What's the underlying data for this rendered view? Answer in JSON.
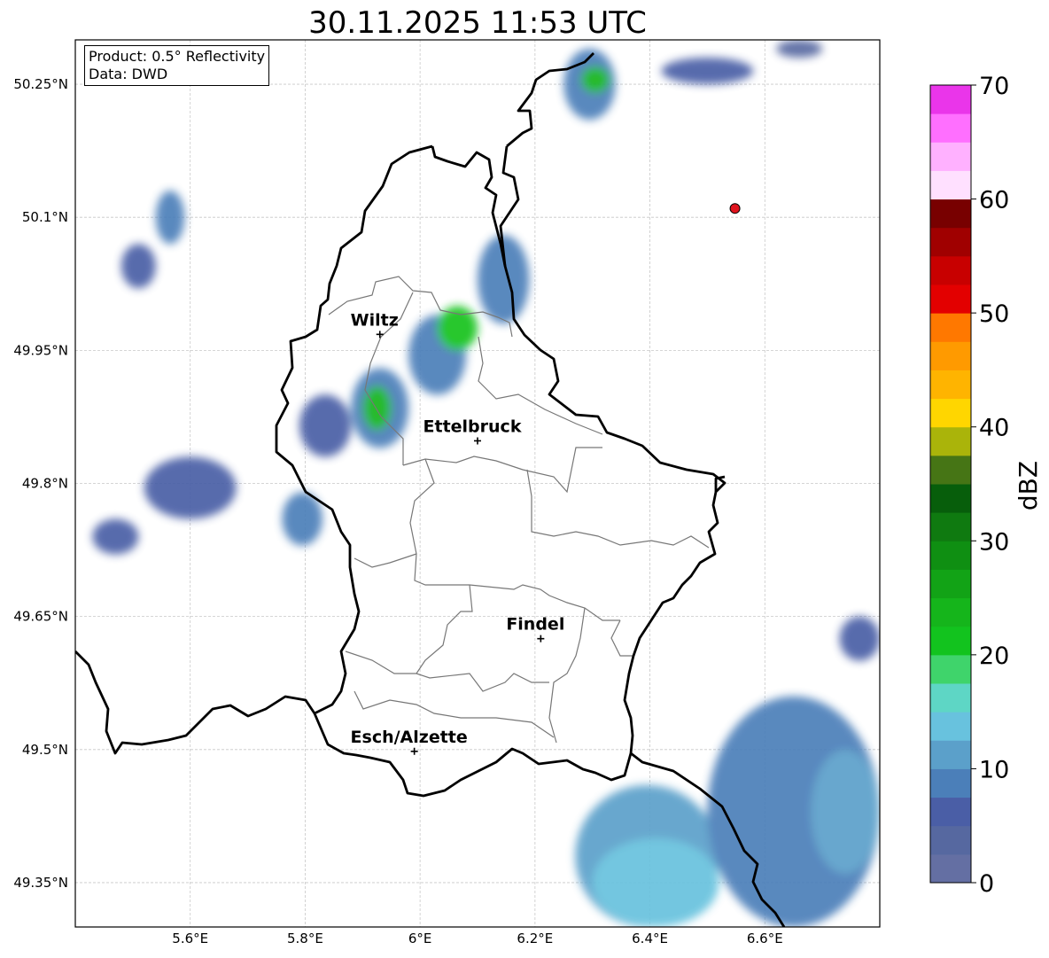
{
  "title": "30.11.2025 11:53 UTC",
  "info": {
    "product_line": "Product: 0.5° Reflectivity",
    "source_line": "Data: DWD"
  },
  "map": {
    "extent": {
      "lon_min": 5.4,
      "lon_max": 6.8,
      "lat_min": 49.3,
      "lat_max": 50.3
    },
    "lon_ticks": [
      {
        "v": 5.6,
        "label": "5.6°E"
      },
      {
        "v": 5.8,
        "label": "5.8°E"
      },
      {
        "v": 6.0,
        "label": "6°E"
      },
      {
        "v": 6.2,
        "label": "6.2°E"
      },
      {
        "v": 6.4,
        "label": "6.4°E"
      },
      {
        "v": 6.6,
        "label": "6.6°E"
      }
    ],
    "lat_ticks": [
      {
        "v": 50.25,
        "label": "50.25°N"
      },
      {
        "v": 50.1,
        "label": "50.1°N"
      },
      {
        "v": 49.95,
        "label": "49.95°N"
      },
      {
        "v": 49.8,
        "label": "49.8°N"
      },
      {
        "v": 49.65,
        "label": "49.65°N"
      },
      {
        "v": 49.5,
        "label": "49.5°N"
      },
      {
        "v": 49.35,
        "label": "49.35°N"
      }
    ],
    "cities": [
      {
        "name": "Wiltz",
        "lon": 5.93,
        "lat": 49.968
      },
      {
        "name": "Ettelbruck",
        "lon": 6.1,
        "lat": 49.848
      },
      {
        "name": "Findel",
        "lon": 6.21,
        "lat": 49.625
      },
      {
        "name": "Esch/Alzette",
        "lon": 5.99,
        "lat": 49.498
      }
    ],
    "radar_site": {
      "lon": 6.548,
      "lat": 50.11,
      "color": "#e0141e"
    }
  },
  "colorbar": {
    "label": "dBZ",
    "min": 0,
    "max": 70,
    "step": 2.5,
    "ticks": [
      {
        "v": 0,
        "label": "0"
      },
      {
        "v": 10,
        "label": "10"
      },
      {
        "v": 20,
        "label": "20"
      },
      {
        "v": 30,
        "label": "30"
      },
      {
        "v": 40,
        "label": "40"
      },
      {
        "v": 50,
        "label": "50"
      },
      {
        "v": 60,
        "label": "60"
      },
      {
        "v": 70,
        "label": "70"
      }
    ],
    "colors": [
      "#646fa3",
      "#5668a0",
      "#4a5ea6",
      "#4b7fb9",
      "#5ba0ca",
      "#68c2de",
      "#5ed6c5",
      "#3fd46b",
      "#12c31e",
      "#15b51b",
      "#12a316",
      "#0f8f12",
      "#0f7a10",
      "#075e0b",
      "#467515",
      "#aab40a",
      "#ffd600",
      "#ffb400",
      "#ff9a00",
      "#ff7800",
      "#e30000",
      "#c80000",
      "#a00000",
      "#780000",
      "#ffe0ff",
      "#ffb1ff",
      "#ff6fff",
      "#ea35ea"
    ]
  },
  "radar_echoes": [
    {
      "lon": [
        6.25,
        6.34
      ],
      "lat": [
        50.21,
        50.29
      ],
      "dbz": 8
    },
    {
      "lon": [
        6.28,
        6.33
      ],
      "lat": [
        50.24,
        50.27
      ],
      "dbz": 24
    },
    {
      "lon": [
        6.42,
        6.58
      ],
      "lat": [
        50.25,
        50.28
      ],
      "dbz": 6
    },
    {
      "lon": [
        6.62,
        6.7
      ],
      "lat": [
        50.28,
        50.3
      ],
      "dbz": 4
    },
    {
      "lon": [
        5.48,
        5.54
      ],
      "lat": [
        50.02,
        50.07
      ],
      "dbz": 6
    },
    {
      "lon": [
        5.54,
        5.59
      ],
      "lat": [
        50.07,
        50.13
      ],
      "dbz": 8
    },
    {
      "lon": [
        5.88,
        5.98
      ],
      "lat": [
        49.84,
        49.93
      ],
      "dbz": 8
    },
    {
      "lon": [
        5.9,
        5.95
      ],
      "lat": [
        49.86,
        49.91
      ],
      "dbz": 24
    },
    {
      "lon": [
        5.98,
        6.08
      ],
      "lat": [
        49.9,
        49.99
      ],
      "dbz": 8
    },
    {
      "lon": [
        6.03,
        6.1
      ],
      "lat": [
        49.95,
        50.0
      ],
      "dbz": 22
    },
    {
      "lon": [
        6.1,
        6.19
      ],
      "lat": [
        49.98,
        50.08
      ],
      "dbz": 8
    },
    {
      "lon": [
        5.79,
        5.88
      ],
      "lat": [
        49.83,
        49.9
      ],
      "dbz": 6
    },
    {
      "lon": [
        5.43,
        5.51
      ],
      "lat": [
        49.72,
        49.76
      ],
      "dbz": 6
    },
    {
      "lon": [
        5.52,
        5.68
      ],
      "lat": [
        49.76,
        49.83
      ],
      "dbz": 6
    },
    {
      "lon": [
        5.76,
        5.83
      ],
      "lat": [
        49.73,
        49.79
      ],
      "dbz": 8
    },
    {
      "lon": [
        6.73,
        6.8
      ],
      "lat": [
        49.6,
        49.65
      ],
      "dbz": 6
    },
    {
      "lon": [
        6.27,
        6.52
      ],
      "lat": [
        49.3,
        49.46
      ],
      "dbz": 10
    },
    {
      "lon": [
        6.5,
        6.8
      ],
      "lat": [
        49.3,
        49.56
      ],
      "dbz": 9
    },
    {
      "lon": [
        6.3,
        6.52
      ],
      "lat": [
        49.3,
        49.4
      ],
      "dbz": 13
    },
    {
      "lon": [
        6.68,
        6.8
      ],
      "lat": [
        49.36,
        49.5
      ],
      "dbz": 11
    }
  ]
}
